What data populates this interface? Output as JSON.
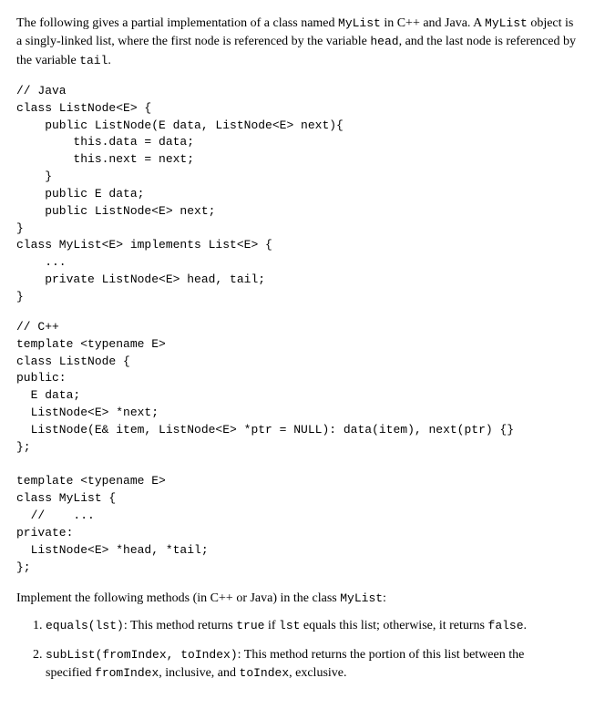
{
  "intro": {
    "t1": "The following gives a partial implementation of a class named ",
    "code1": "MyList",
    "t2": " in C++ and Java. A ",
    "code2": "MyList",
    "t3": " object is a singly-linked list, where the first node is referenced by the variable ",
    "code3": "head",
    "t4": ", and the last node is referenced by the variable ",
    "code4": "tail",
    "t5": "."
  },
  "code_java": "// Java\nclass ListNode<E> {\n    public ListNode(E data, ListNode<E> next){\n        this.data = data;\n        this.next = next;\n    }\n    public E data;\n    public ListNode<E> next;\n}\nclass MyList<E> implements List<E> {\n    ...\n    private ListNode<E> head, tail;\n}",
  "code_cpp": "// C++\ntemplate <typename E>\nclass ListNode {\npublic:\n  E data;\n  ListNode<E> *next;\n  ListNode(E& item, ListNode<E> *ptr = NULL): data(item), next(ptr) {}\n};\n\ntemplate <typename E>\nclass MyList {\n  //    ...\nprivate:\n  ListNode<E> *head, *tail;\n};",
  "instr": {
    "t1": "Implement the following methods (in C++ or Java) in the class ",
    "code1": "MyList",
    "t2": ":"
  },
  "methods": {
    "m1": {
      "sig": "equals(lst)",
      "t1": ": This method returns ",
      "c1": "true",
      "t2": " if ",
      "c2": "lst",
      "t3": " equals this list; otherwise, it returns ",
      "c3": "false",
      "t4": "."
    },
    "m2": {
      "sig": "subList(fromIndex, toIndex)",
      "t1": ": This method returns the portion of this list between the specified ",
      "c1": "fromIndex",
      "t2": ", inclusive, and ",
      "c2": "toIndex",
      "t3": ", exclusive."
    }
  }
}
